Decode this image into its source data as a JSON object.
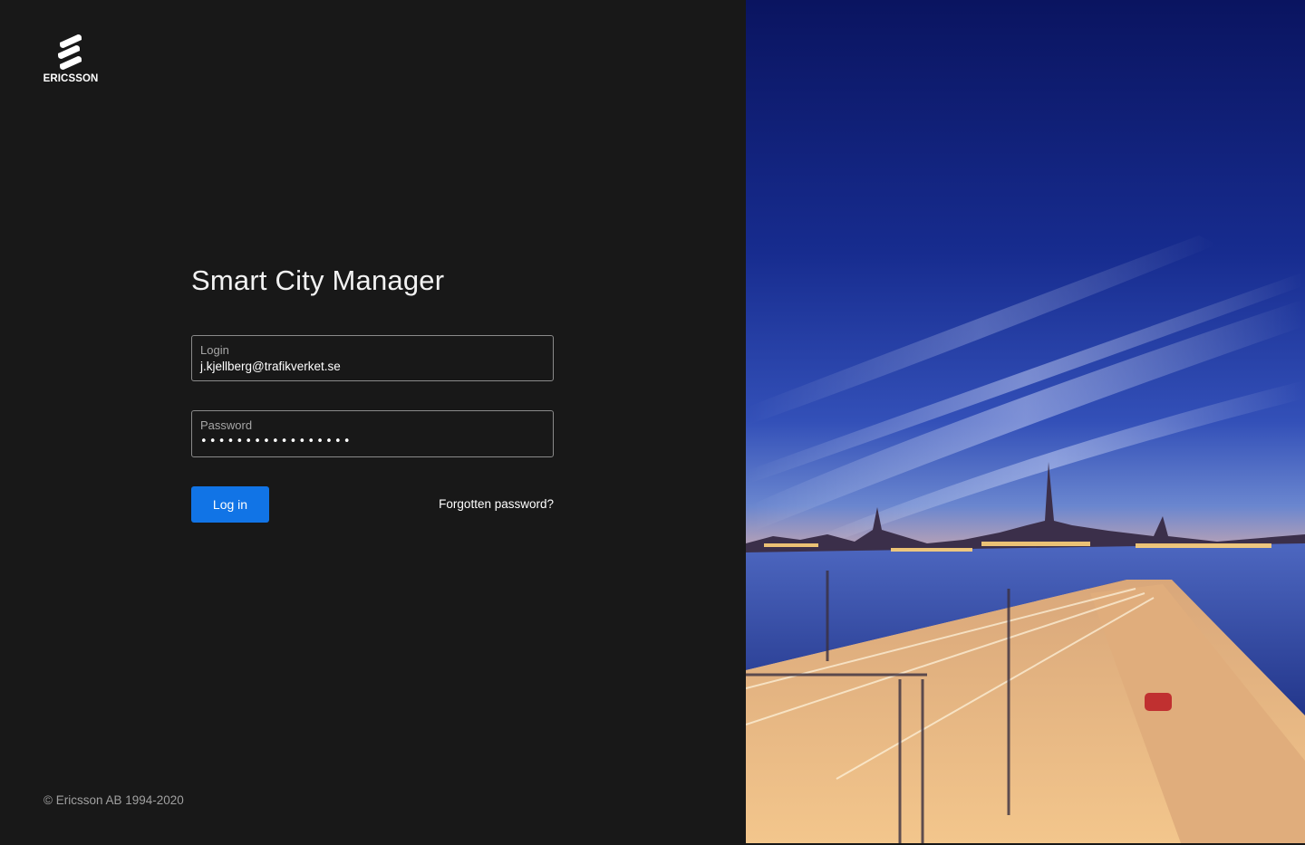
{
  "brand": {
    "logo_text": "ERICSSON"
  },
  "title": "Smart City Manager",
  "login_field": {
    "label": "Login",
    "value": "j.kjellberg@trafikverket.se"
  },
  "password_field": {
    "label": "Password",
    "masked_value": "•••••••••••••••••"
  },
  "actions": {
    "login_label": "Log in",
    "forgot_label": "Forgotten password?"
  },
  "footer": {
    "copyright": "© Ericsson AB 1994-2020"
  },
  "colors": {
    "background": "#181818",
    "accent": "#1174e6"
  },
  "hero_image": {
    "icon": "city-night-photo"
  }
}
